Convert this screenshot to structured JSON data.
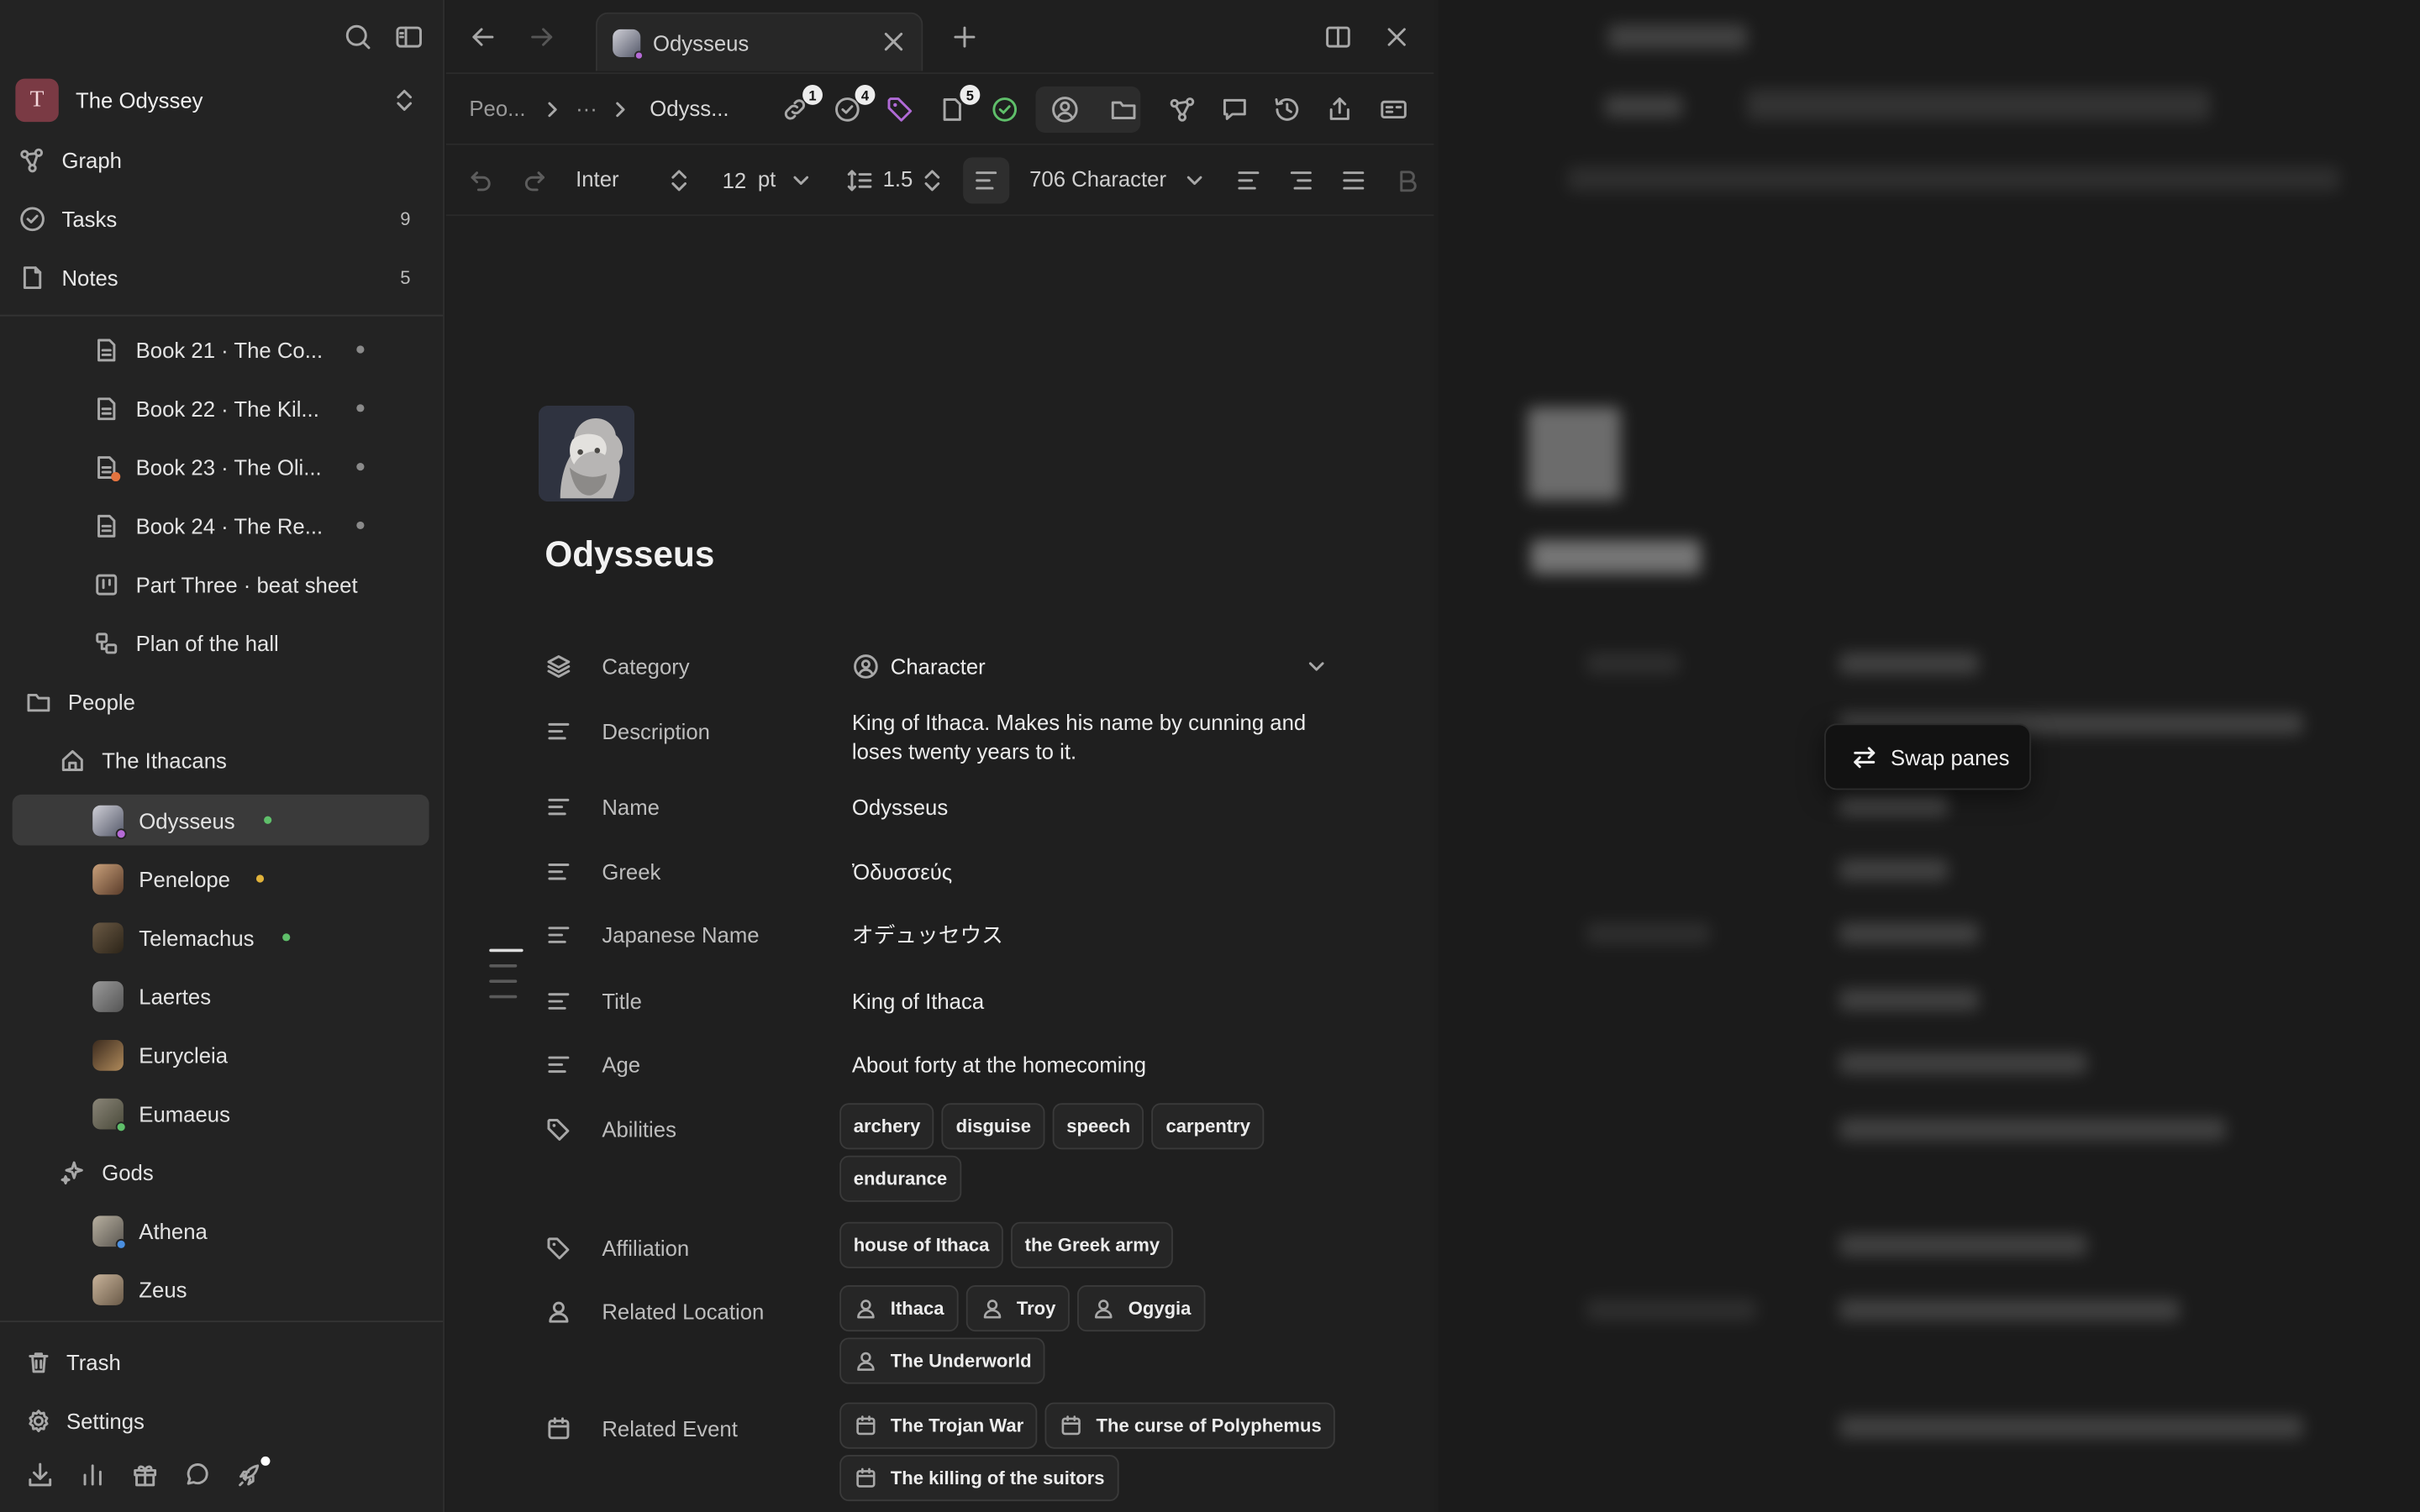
{
  "workspace": {
    "name": "The Odyssey",
    "initial": "T"
  },
  "nav": {
    "graph": "Graph",
    "tasks": "Tasks",
    "tasks_count": "9",
    "notes": "Notes",
    "notes_count": "5"
  },
  "tree": {
    "docs": [
      {
        "label": "Book 21 · The Co..."
      },
      {
        "label": "Book 22 · The Kil..."
      },
      {
        "label": "Book 23 · The Oli..."
      },
      {
        "label": "Book 24 · The Re..."
      }
    ],
    "beat_sheet": "Part Three · beat sheet",
    "plan": "Plan of the hall",
    "people": "People",
    "ithacans": "The Ithacans",
    "characters": [
      {
        "label": "Odysseus",
        "status_color": "#5fbf6a"
      },
      {
        "label": "Penelope",
        "status_color": "#e0b23a"
      },
      {
        "label": "Telemachus",
        "status_color": "#5fbf6a"
      },
      {
        "label": "Laertes"
      },
      {
        "label": "Eurycleia"
      },
      {
        "label": "Eumaeus"
      }
    ],
    "gods": "Gods",
    "gods_items": [
      {
        "label": "Athena"
      },
      {
        "label": "Zeus"
      }
    ]
  },
  "sidebar_bottom": {
    "trash": "Trash",
    "settings": "Settings"
  },
  "tab": {
    "title": "Odysseus"
  },
  "breadcrumb": {
    "first": "Peo...",
    "ellipsis": "···",
    "current": "Odyss..."
  },
  "badges": {
    "links": "1",
    "tasks": "4",
    "docs": "5"
  },
  "format": {
    "font": "Inter",
    "size": "12",
    "unit": "pt",
    "line_height": "1.5",
    "template": "706 Character"
  },
  "doc": {
    "title": "Odysseus",
    "properties": {
      "category_label": "Category",
      "category_value": "Character",
      "description_label": "Description",
      "description_value": "King of Ithaca. Makes his name by cunning and loses twenty years to it.",
      "name_label": "Name",
      "name_value": "Odysseus",
      "greek_label": "Greek",
      "greek_value": "Ὀδυσσεύς",
      "japanese_label": "Japanese Name",
      "japanese_value": "オデュッセウス",
      "title_label": "Title",
      "title_value": "King of Ithaca",
      "age_label": "Age",
      "age_value": "About forty at the homecoming",
      "abilities_label": "Abilities",
      "abilities": [
        "archery",
        "disguise",
        "speech",
        "carpentry",
        "endurance"
      ],
      "affiliation_label": "Affiliation",
      "affiliation": [
        "house of Ithaca",
        "the Greek army"
      ],
      "location_label": "Related Location",
      "locations": [
        "Ithaca",
        "Troy",
        "Ogygia",
        "The Underworld"
      ],
      "event_label": "Related Event",
      "events": [
        "The Trojan War",
        "The curse of Polyphemus",
        "The killing of the suitors"
      ]
    }
  },
  "swap_panes": "Swap panes"
}
